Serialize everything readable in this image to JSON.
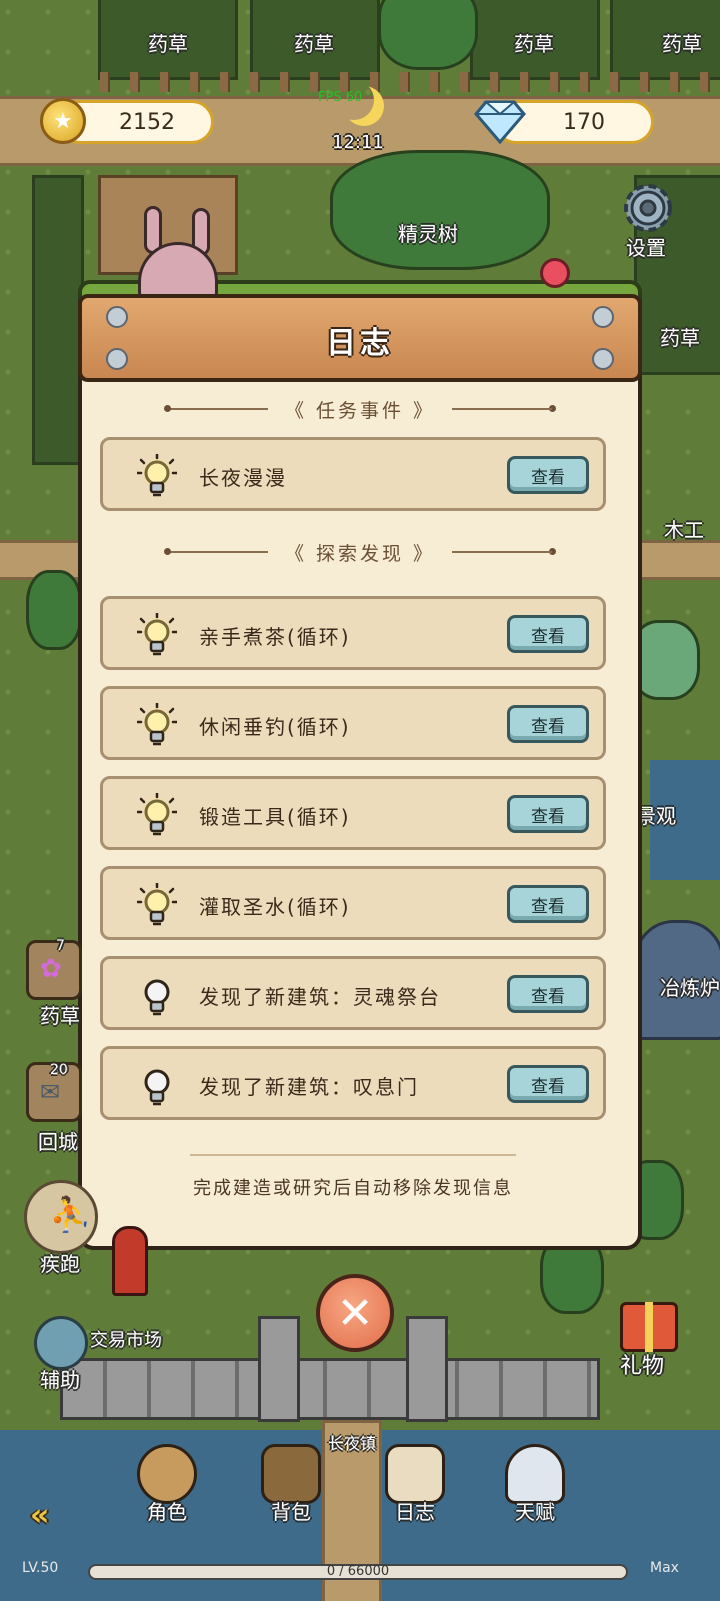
{
  "hud": {
    "coins": "2152",
    "gems": "170",
    "time": "12:11",
    "fps": "FPS 60",
    "settings_label": "设置"
  },
  "map_labels": {
    "herb_field_1": "药草",
    "herb_field_2": "药草",
    "herb_field_3": "药草",
    "herb_field_4": "药草",
    "herb_field_5": "药草",
    "spirit_tree": "精灵树",
    "woodwork": "木工",
    "scenery": "景观",
    "smelter": "冶炼炉",
    "gate": "长夜镇",
    "market": "交易市场"
  },
  "dialog": {
    "title": "日志",
    "section_tasks": "《 任务事件 》",
    "section_explore": "《 探索发现 》",
    "view_label": "查看",
    "task_entries": [
      {
        "label": "长夜漫漫",
        "active": true
      }
    ],
    "explore_entries": [
      {
        "label": "亲手煮茶(循环)",
        "active": true
      },
      {
        "label": "休闲垂钓(循环)",
        "active": true
      },
      {
        "label": "锻造工具(循环)",
        "active": true
      },
      {
        "label": "灌取圣水(循环)",
        "active": true
      },
      {
        "label": "发现了新建筑：灵魂祭台",
        "active": false
      },
      {
        "label": "发现了新建筑：叹息门",
        "active": false
      }
    ],
    "footer": "完成建造或研究后自动移除发现信息"
  },
  "side": {
    "herb_count": "7",
    "herb_label": "药草",
    "recall_count": "20",
    "recall_label": "回城",
    "sprint_label": "疾跑",
    "assist_label": "辅助",
    "gift_label": "礼物"
  },
  "bottom_nav": {
    "character": "角色",
    "backpack": "背包",
    "journal": "日志",
    "talent": "天赋"
  },
  "xp": {
    "level": "LV.50",
    "progress": "0 / 66000",
    "max": "Max",
    "fraction": 0
  },
  "colors": {
    "accent_gold": "#d6a42a",
    "panel": "#f7ecd4",
    "button": "#a7d4d8",
    "close": "#e26d4a"
  }
}
